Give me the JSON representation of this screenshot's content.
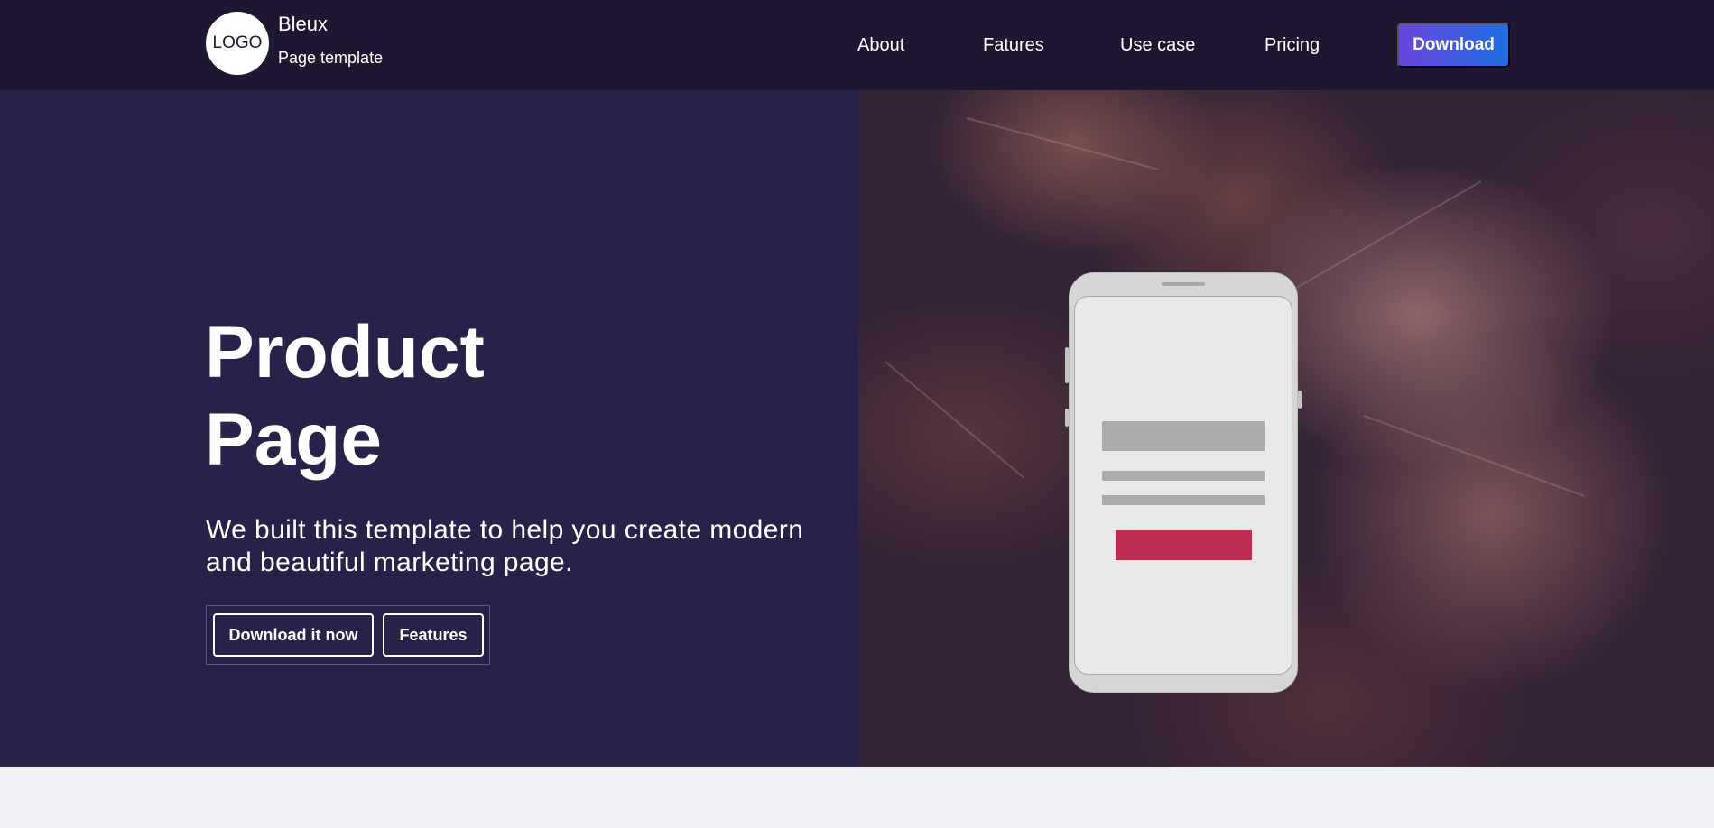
{
  "brand": {
    "logo_text": "LOGO",
    "name": "Bleux",
    "tagline": "Page template"
  },
  "nav": {
    "links": [
      "About",
      "Fatures",
      "Use case",
      "Pricing"
    ],
    "cta_label": "Download"
  },
  "hero": {
    "title_line1": "Product",
    "title_line2": "Page",
    "subtitle": "We built this template to help you create modern and beautiful marketing page.",
    "primary_button": "Download it now",
    "secondary_button": "Features"
  },
  "colors": {
    "nav_bg": "#1f1731",
    "hero_bg": "#28214a",
    "cta_gradient_start": "#6a45dc",
    "cta_gradient_end": "#1e6ee2",
    "mockup_cta": "#bd2d51",
    "page_bg": "#f0f1f6"
  },
  "icons": {
    "logo": "logo-circle",
    "hero_image": "phone-mockup-on-leaves"
  }
}
